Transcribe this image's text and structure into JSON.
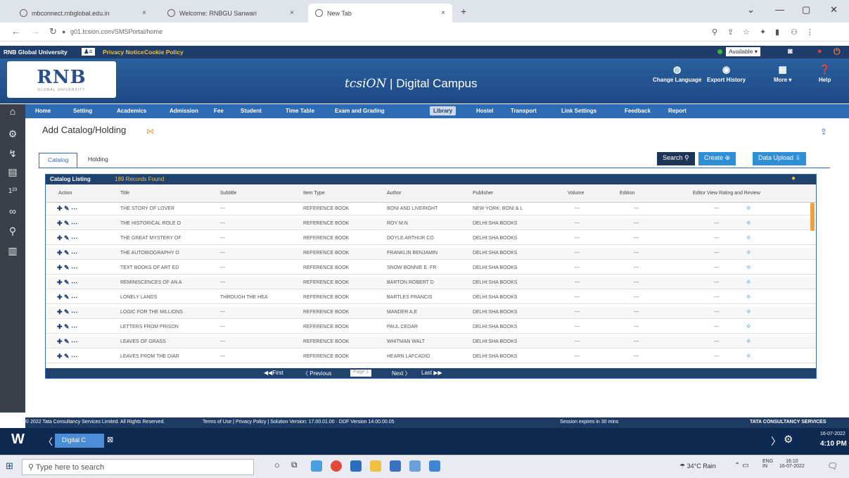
{
  "browser": {
    "tabs": [
      {
        "title": "mbconnect.rnbglobal.edu.in",
        "x": "×"
      },
      {
        "title": "Welcome: RNBGU Sanwari",
        "x": "×"
      },
      {
        "title": "New Tab",
        "x": "×"
      }
    ],
    "newtab": "+",
    "url": "g01.tcsion.com/SMSPortal/home"
  },
  "topstrip": {
    "university": "RNB Global University",
    "privacy": "Privacy Notice",
    "cookie": "Cookie Policy",
    "status": "Available"
  },
  "header": {
    "logo": "RNB",
    "logo_sub": "GLOBAL UNIVERSITY",
    "brand_tcs": "tcsiON",
    "brand_rest": " | Digital Campus",
    "change_language": "Change Language",
    "export_history": "Export History",
    "more": "More ▾",
    "help": "Help"
  },
  "menu": [
    "Home",
    "Setting",
    "Academics",
    "Admission",
    "Fee",
    "Student",
    "Time Table",
    "Exam and Grading",
    "Library",
    "Hostel",
    "Transport",
    "Link Settings",
    "Feedback",
    "Report"
  ],
  "page": {
    "title": "Add Catalog/Holding",
    "tabs": [
      "Catalog",
      "Holding"
    ],
    "search": "Search",
    "create": "Create",
    "upload": "Data Upload"
  },
  "panel": {
    "title": "Catalog Listing",
    "count": "189 Records Found"
  },
  "columns": [
    "Action",
    "Title",
    "Subtitle",
    "Item Type",
    "Author",
    "Publisher",
    "Volume",
    "Edition",
    "Editor",
    "View Rating and Review"
  ],
  "rows": [
    {
      "title": "THE STORY OF LOVER",
      "subtitle": "---",
      "type": "REFERENCE BOOK",
      "author": "BONI AND LIVERIGHT",
      "publisher": "NEW YORK: BONI & L",
      "volume": "---",
      "edition": "---",
      "editor": "---"
    },
    {
      "title": "THE HISTORICAL ROLE O",
      "subtitle": "---",
      "type": "REFERENCE BOOK",
      "author": "ROY M.N",
      "publisher": "DELHI:SHA BOOKS",
      "volume": "---",
      "edition": "---",
      "editor": "---"
    },
    {
      "title": "THE GREAT MYSTERY OF",
      "subtitle": "---",
      "type": "REFERENCE BOOK",
      "author": "DOYLE ARTHUR CO",
      "publisher": "DELHI:SHA BOOKS",
      "volume": "---",
      "edition": "---",
      "editor": "---"
    },
    {
      "title": "THE AUTOBIOGRAPHY O",
      "subtitle": "---",
      "type": "REFERENCE BOOK",
      "author": "FRANKLIN BENJAMIN",
      "publisher": "DELHI:SHA BOOKS",
      "volume": "---",
      "edition": "---",
      "editor": "---"
    },
    {
      "title": "TEXT BOOKS OF ART ED",
      "subtitle": "---",
      "type": "REFERENCE BOOK",
      "author": "SNOW BONNIE E. FR",
      "publisher": "DELHI:SHA BOOKS",
      "volume": "---",
      "edition": "---",
      "editor": "---"
    },
    {
      "title": "REMINISCENCES OF AN A",
      "subtitle": "---",
      "type": "REFERENCE BOOK",
      "author": "BARTON ROBERT D",
      "publisher": "DELHI:SHA BOOKS",
      "volume": "---",
      "edition": "---",
      "editor": "---"
    },
    {
      "title": "LONELY LANDS",
      "subtitle": "THROUGH THE HEA",
      "type": "REFERENCE BOOK",
      "author": "BARTLES FRANCIS",
      "publisher": "DELHI:SHA BOOKS",
      "volume": "---",
      "edition": "---",
      "editor": "---"
    },
    {
      "title": "LOGIC FOR THE MILLIONS",
      "subtitle": "---",
      "type": "REFERENCE BOOK",
      "author": "MANDER A.E",
      "publisher": "DELHI:SHA BOOKS",
      "volume": "---",
      "edition": "---",
      "editor": "---"
    },
    {
      "title": "LETTERS FROM PRISON",
      "subtitle": "---",
      "type": "REFERENCE BOOK",
      "author": "PAUL CEDAR",
      "publisher": "DELHI:SHA BOOKS",
      "volume": "---",
      "edition": "---",
      "editor": "---"
    },
    {
      "title": "LEAVES OF GRASS",
      "subtitle": "---",
      "type": "REFERENCE BOOK",
      "author": "WHITMAN WALT",
      "publisher": "DELHI:SHA BOOKS",
      "volume": "---",
      "edition": "---",
      "editor": "---"
    },
    {
      "title": "LEAVES FROM THE DIAR",
      "subtitle": "---",
      "type": "REFERENCE BOOK",
      "author": "HEARN LAFCADIO",
      "publisher": "DELHI:SHA BOOKS",
      "volume": "---",
      "edition": "---",
      "editor": "---"
    }
  ],
  "pager": {
    "first": "First",
    "prev": "Previous",
    "page": "Page 1",
    "next": "Next",
    "last": "Last"
  },
  "footer": {
    "copyright": "© 2022 Tata Consultancy Services Limited. All Rights Reserved.",
    "terms": "Terms of Use | Privacy Policy | Solution Version: 17.00.01.00 · DDF Version 14.00.00.05",
    "session": "Session expires in 30 mins",
    "tcs": "TATA CONSULTANCY SERVICES"
  },
  "wintask": {
    "app": "Digital C",
    "time": "4:10 PM",
    "date": "16-07-2022"
  },
  "taskbar": {
    "search": "Type here to search",
    "weather": "34°C Rain",
    "lang": "ENG",
    "lang2": "IN",
    "clock": "16:10",
    "date": "16-07-2022"
  }
}
